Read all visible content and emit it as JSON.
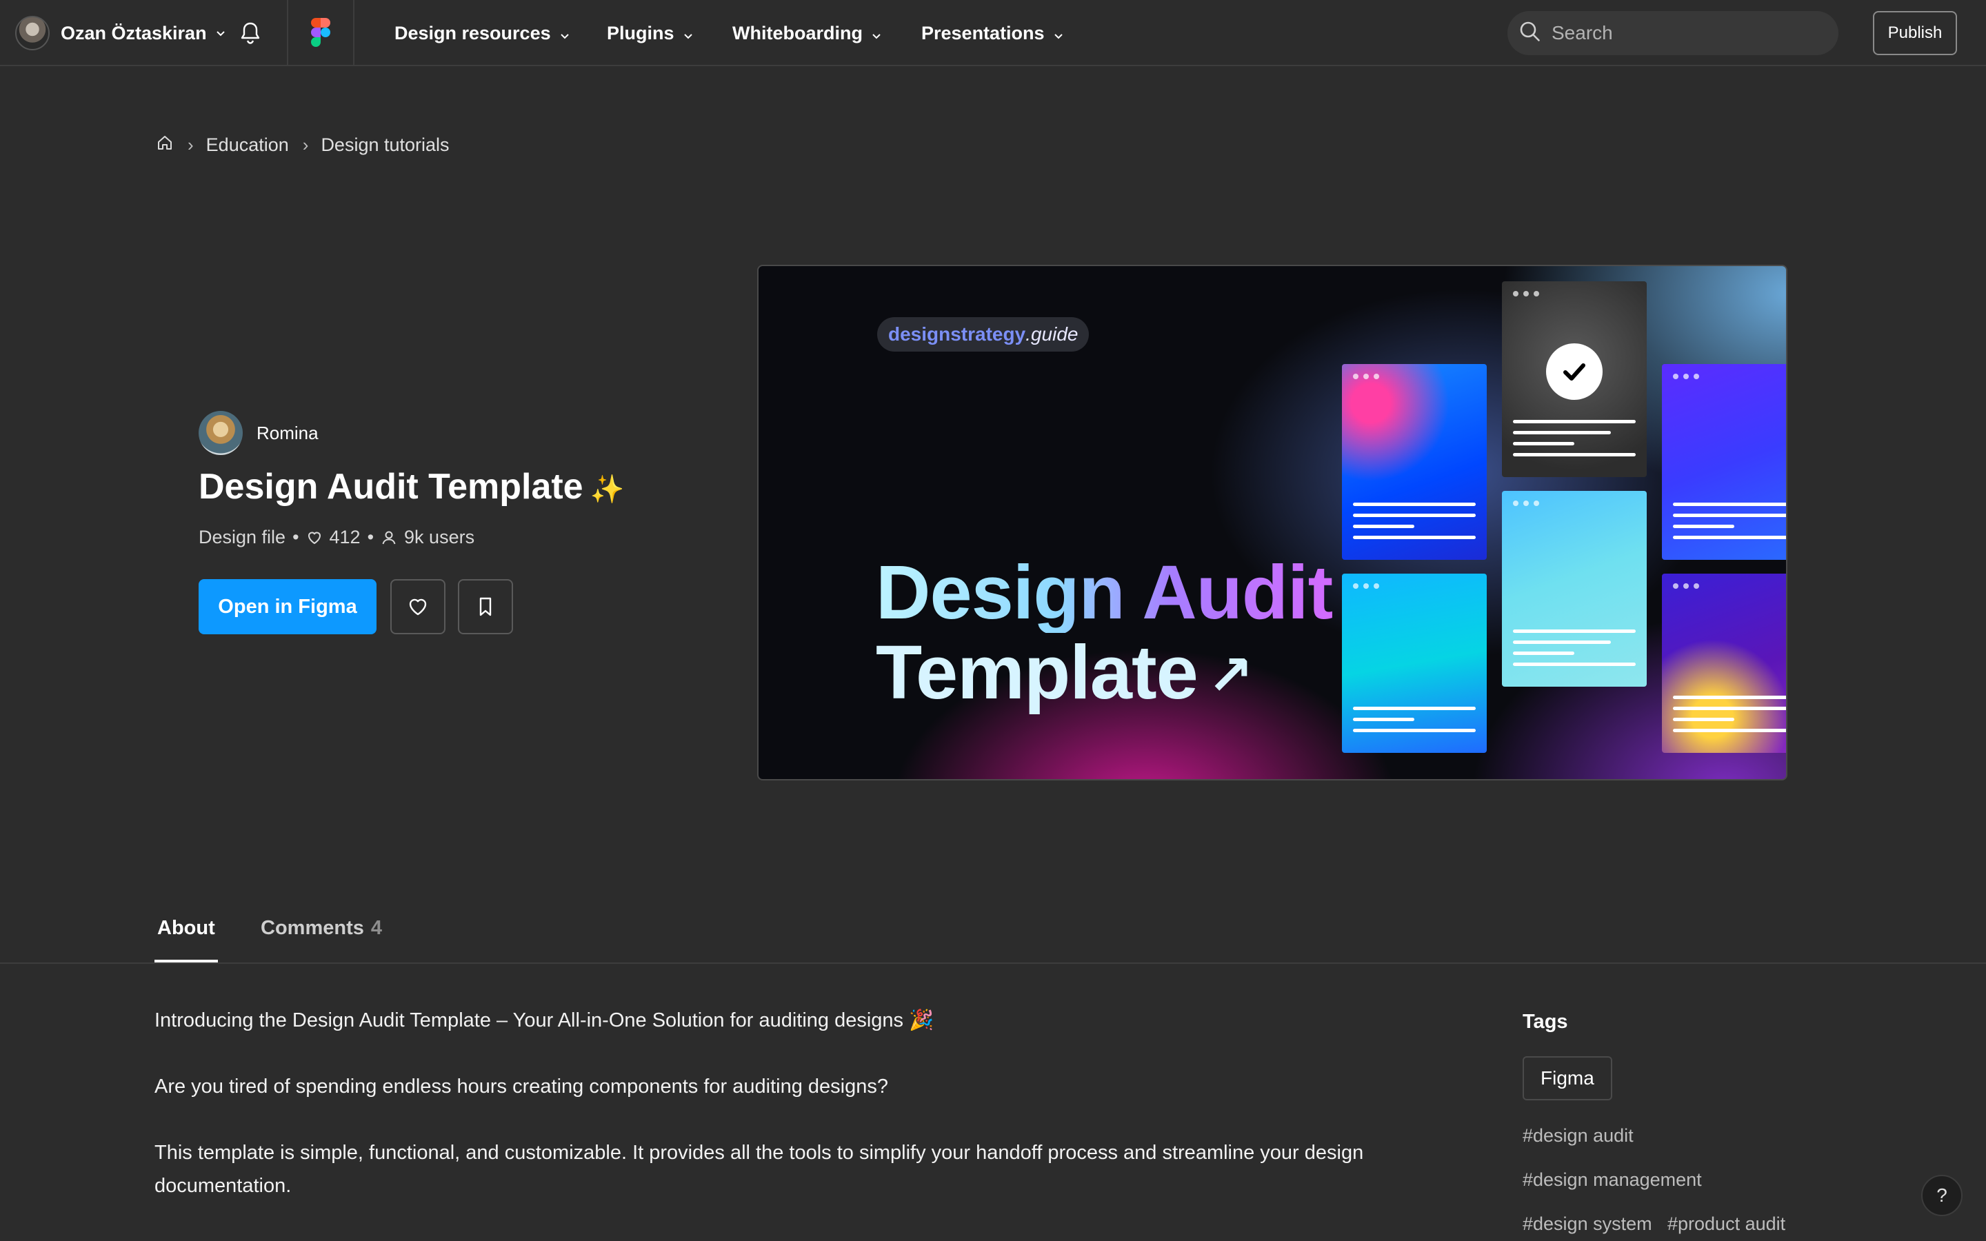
{
  "topbar": {
    "user_name": "Ozan Öztaskiran",
    "nav": [
      {
        "label": "Design resources"
      },
      {
        "label": "Plugins"
      },
      {
        "label": "Whiteboarding"
      },
      {
        "label": "Presentations"
      }
    ],
    "search_placeholder": "Search",
    "publish_label": "Publish",
    "icons": {
      "notifications": "bell-icon",
      "logo": "figma-logo-icon",
      "search": "search-icon"
    }
  },
  "breadcrumb": {
    "items": [
      "Education",
      "Design tutorials"
    ],
    "home_icon": "home-icon"
  },
  "resource": {
    "author": "Romina",
    "title": "Design Audit Template",
    "title_emoji": "✨",
    "type": "Design file",
    "likes": "412",
    "users": "9k users",
    "open_label": "Open in Figma",
    "like_icon": "heart-icon",
    "save_icon": "bookmark-icon"
  },
  "preview": {
    "brand_strong": "designstrategy",
    "brand_light": ".guide",
    "title_line1": "Design Audit",
    "title_line2": "Template",
    "arrow": "↗"
  },
  "tabs": {
    "about": "About",
    "comments": "Comments",
    "comments_count": "4"
  },
  "about": {
    "paragraphs": [
      "Introducing the Design Audit Template – Your All-in-One Solution for auditing designs 🎉",
      "Are you tired of spending endless hours creating components for auditing designs?",
      "This template is simple, functional, and customizable. It provides all the tools to simplify your handoff process and streamline your design documentation."
    ]
  },
  "tags": {
    "title": "Tags",
    "chip": "Figma",
    "hashtags": [
      "#design audit",
      "#design management",
      "#design system",
      "#product audit"
    ]
  },
  "help_label": "?",
  "colors": {
    "background": "#2c2c2c",
    "accent": "#0d99ff",
    "divider": "#3d3d3d"
  }
}
